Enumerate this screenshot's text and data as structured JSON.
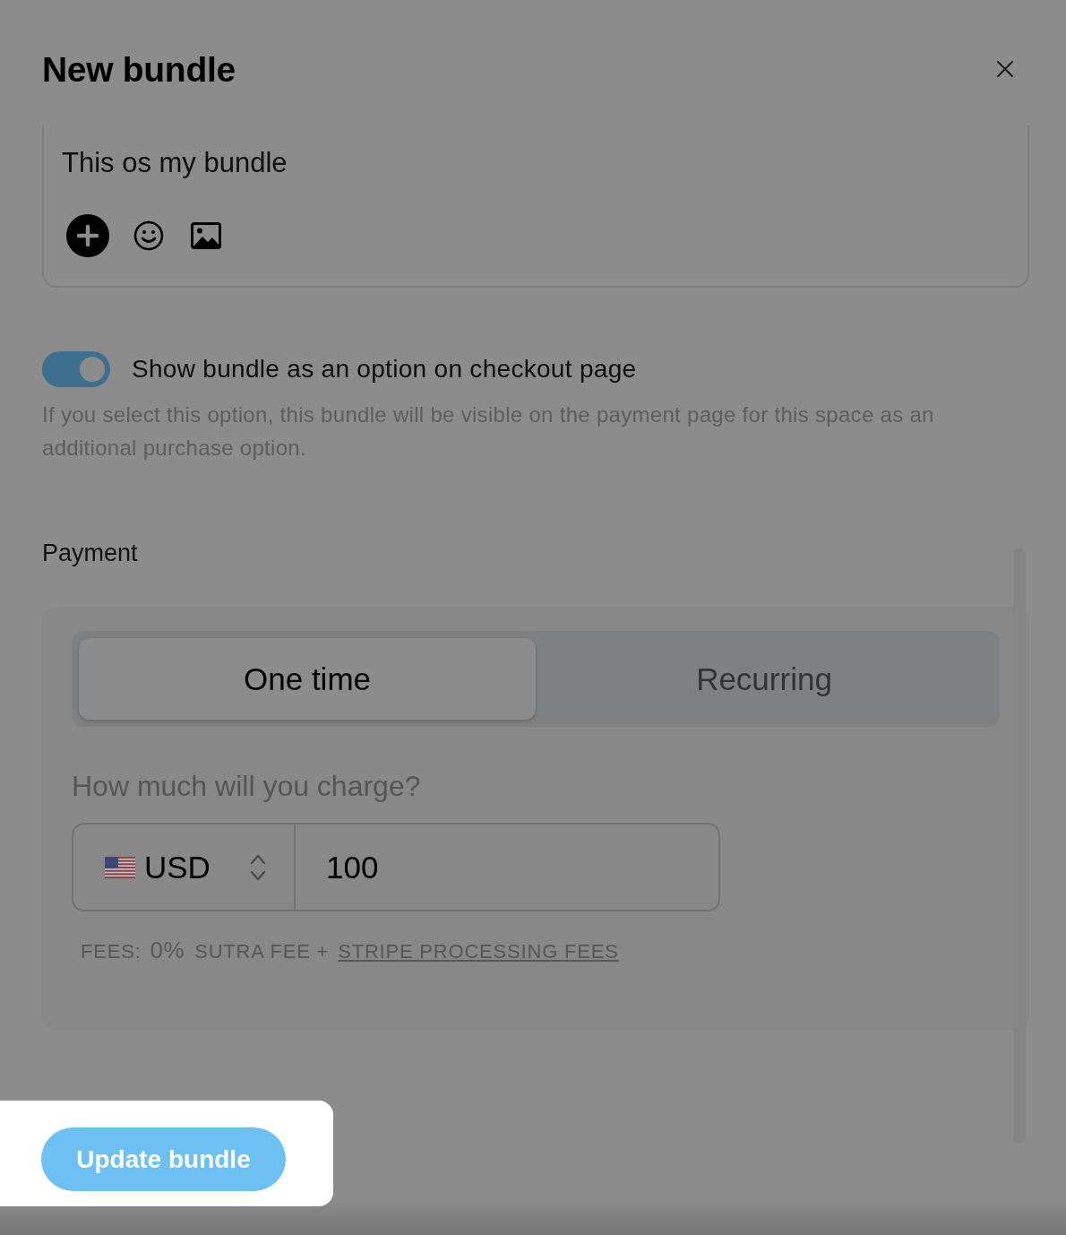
{
  "dialog": {
    "title": "New bundle"
  },
  "description_editor": {
    "value": "This os my bundle"
  },
  "checkout_option": {
    "label": "Show bundle as an option on checkout page",
    "on": true,
    "help": "If you select this option, this bundle will be visible on the payment page for this space as an additional purchase option."
  },
  "payment": {
    "heading": "Payment",
    "tabs": [
      {
        "label": "One time",
        "selected": true
      },
      {
        "label": "Recurring",
        "selected": false
      }
    ],
    "price_question": "How much will you charge?",
    "currency": {
      "code": "USD"
    },
    "amount": {
      "value": "100"
    },
    "fees": {
      "label": "FEES:",
      "percent": "0%",
      "fee_name": "SUTRA FEE +",
      "link": "STRIPE PROCESSING FEES"
    }
  },
  "submit_button": {
    "label": "Update bundle"
  }
}
